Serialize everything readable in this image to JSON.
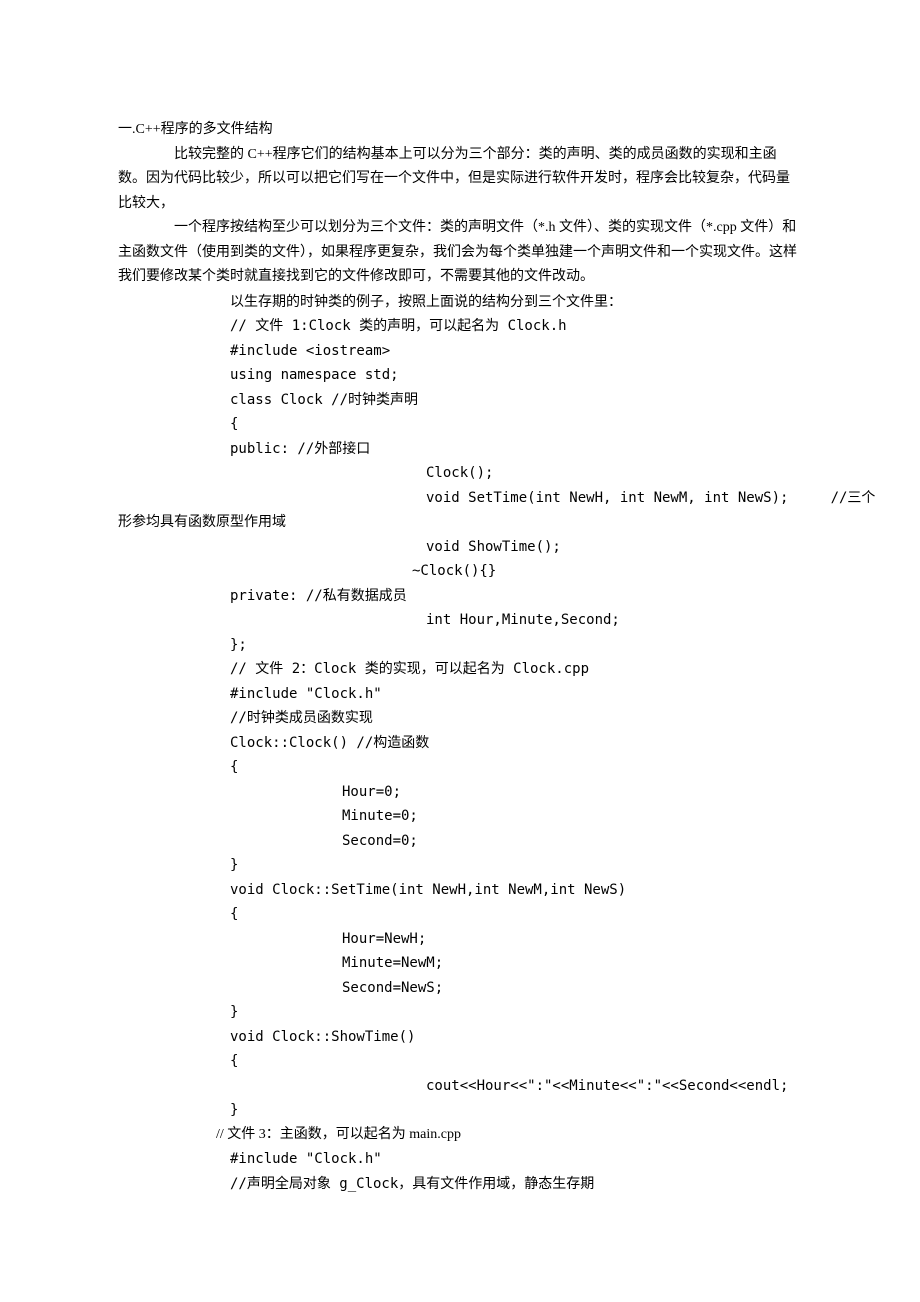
{
  "title": "一.C++程序的多文件结构",
  "p1": "比较完整的 C++程序它们的结构基本上可以分为三个部分：类的声明、类的成员函数的实现和主函数。因为代码比较少，所以可以把它们写在一个文件中，但是实际进行软件开发时，程序会比较复杂，代码量比较大，",
  "p2": "一个程序按结构至少可以划分为三个文件：类的声明文件（*.h 文件）、类的实现文件（*.cpp 文件）和主函数文件（使用到类的文件），如果程序更复杂，我们会为每个类单独建一个声明文件和一个实现文件。这样我们要修改某个类时就直接找到它的文件修改即可，不需要其他的文件改动。",
  "c1": "以生存期的时钟类的例子，按照上面说的结构分到三个文件里：",
  "c2": "// 文件 1:Clock 类的声明，可以起名为 Clock.h",
  "c3": "#include <iostream>",
  "c4": "using namespace std;",
  "c5": "class Clock //时钟类声明",
  "c6": "{",
  "c7": "public: //外部接口",
  "c8": "Clock();",
  "c9a": "void SetTime(int NewH, int NewM, int NewS);     //三个",
  "c9b": "形参均具有函数原型作用域",
  "c10": "void ShowTime();",
  "c11": "~Clock(){}",
  "c12": "private: //私有数据成员",
  "c13": "int Hour,Minute,Second;",
  "c14": "};",
  "c15": "// 文件 2：Clock 类的实现，可以起名为 Clock.cpp",
  "c16": "#include \"Clock.h\"",
  "c17": "//时钟类成员函数实现",
  "c18": "Clock::Clock() //构造函数",
  "c19": "{",
  "c20": "Hour=0;",
  "c21": "Minute=0;",
  "c22": "Second=0;",
  "c23": "}",
  "c24": "void Clock::SetTime(int NewH,int NewM,int NewS)",
  "c25": "{",
  "c26": "Hour=NewH;",
  "c27": "Minute=NewM;",
  "c28": "Second=NewS;",
  "c29": "}",
  "c30": "void Clock::ShowTime()",
  "c31": "{",
  "c32": "cout<<Hour<<\":\"<<Minute<<\":\"<<Second<<endl;",
  "c33": "}",
  "c34": "// 文件 3：主函数，可以起名为 main.cpp",
  "c35": "#include \"Clock.h\"",
  "c36": "//声明全局对象 g_Clock，具有文件作用域，静态生存期"
}
